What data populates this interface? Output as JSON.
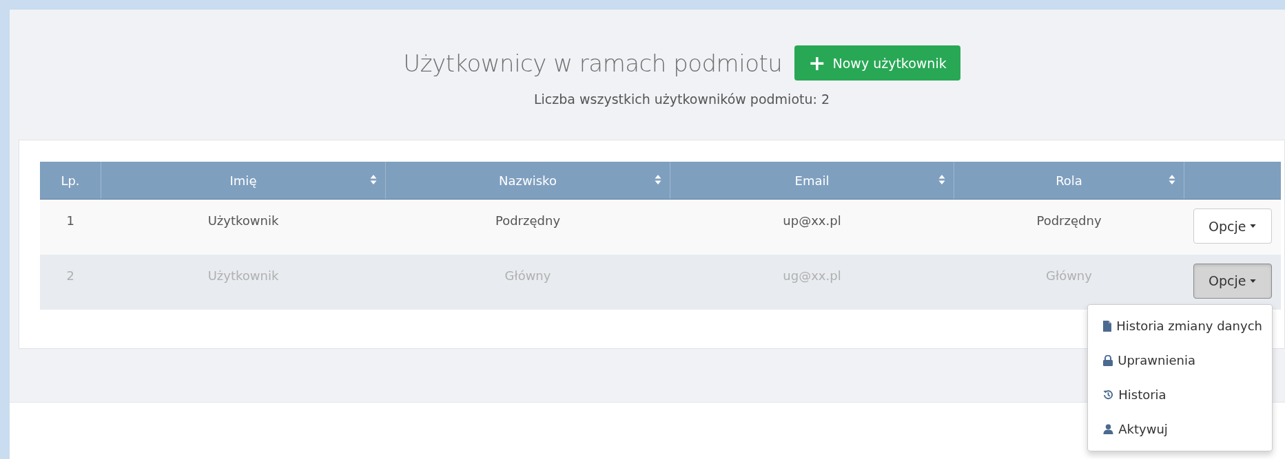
{
  "header": {
    "title": "Użytkownicy w ramach podmiotu",
    "new_button": {
      "icon": "+",
      "label": "Nowy użytkownik"
    },
    "count_text": "Liczba wszystkich użytkowników podmiotu: 2"
  },
  "table": {
    "columns": [
      {
        "label": "Lp.",
        "sortable": false
      },
      {
        "label": "Imię",
        "sortable": true
      },
      {
        "label": "Nazwisko",
        "sortable": true
      },
      {
        "label": "Email",
        "sortable": true
      },
      {
        "label": "Rola",
        "sortable": true
      }
    ],
    "rows": [
      {
        "cells": [
          "1",
          "Użytkownik",
          "Podrzędny",
          "up@xx.pl",
          "Podrzędny"
        ],
        "inactive": false,
        "options_label": "Opcje",
        "menu_open": false
      },
      {
        "cells": [
          "2",
          "Użytkownik",
          "Główny",
          "ug@xx.pl",
          "Główny"
        ],
        "inactive": true,
        "options_label": "Opcje",
        "menu_open": true
      }
    ]
  },
  "options_menu": [
    {
      "kind": "document",
      "label": "Historia zmiany danych"
    },
    {
      "kind": "lock",
      "label": "Uprawnienia"
    },
    {
      "kind": "history",
      "label": "Historia"
    },
    {
      "kind": "user",
      "label": "Aktywuj"
    }
  ]
}
